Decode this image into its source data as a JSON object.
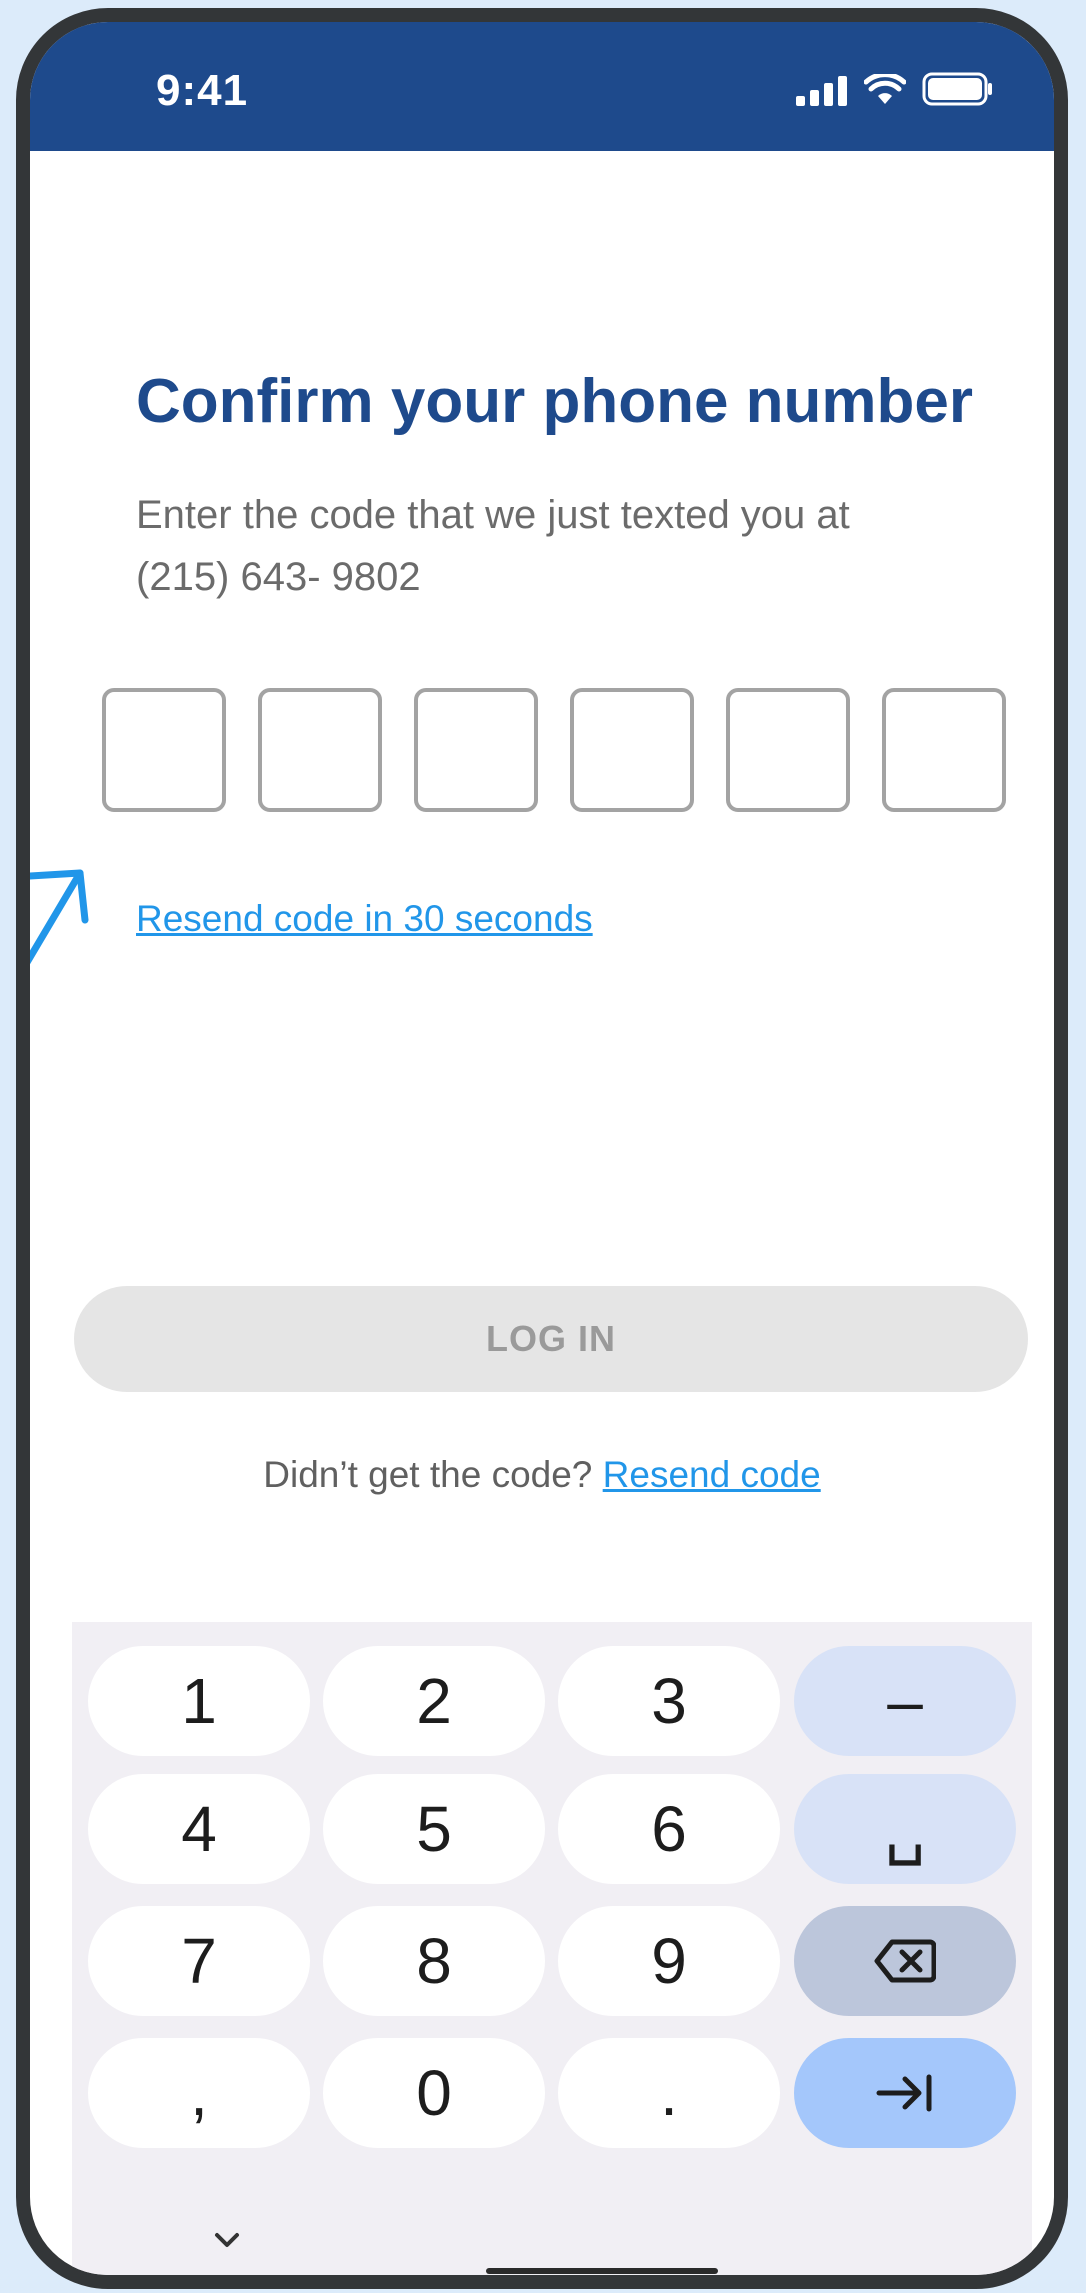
{
  "status_bar": {
    "time": "9:41"
  },
  "screen": {
    "title": "Confirm your phone number",
    "subtitle_line1": "Enter the code that we just texted you at",
    "subtitle_line2": "(215) 643- 9802",
    "code_boxes": [
      "",
      "",
      "",
      "",
      "",
      ""
    ],
    "resend_timer": "Resend code in 30 seconds",
    "login_label": "LOG IN",
    "resend_prompt": "Didn’t get the code?",
    "resend_link": "Resend code"
  },
  "keyboard": {
    "keys": [
      [
        "1",
        "2",
        "3",
        "–"
      ],
      [
        "4",
        "5",
        "6",
        "␣"
      ],
      [
        "7",
        "8",
        "9",
        "backspace-icon"
      ],
      [
        ",",
        "0",
        ".",
        "tab-next-icon"
      ]
    ]
  },
  "colors": {
    "brand": "#1e4a8c",
    "link": "#2196e9",
    "disabled_button": "#e5e5e5"
  }
}
